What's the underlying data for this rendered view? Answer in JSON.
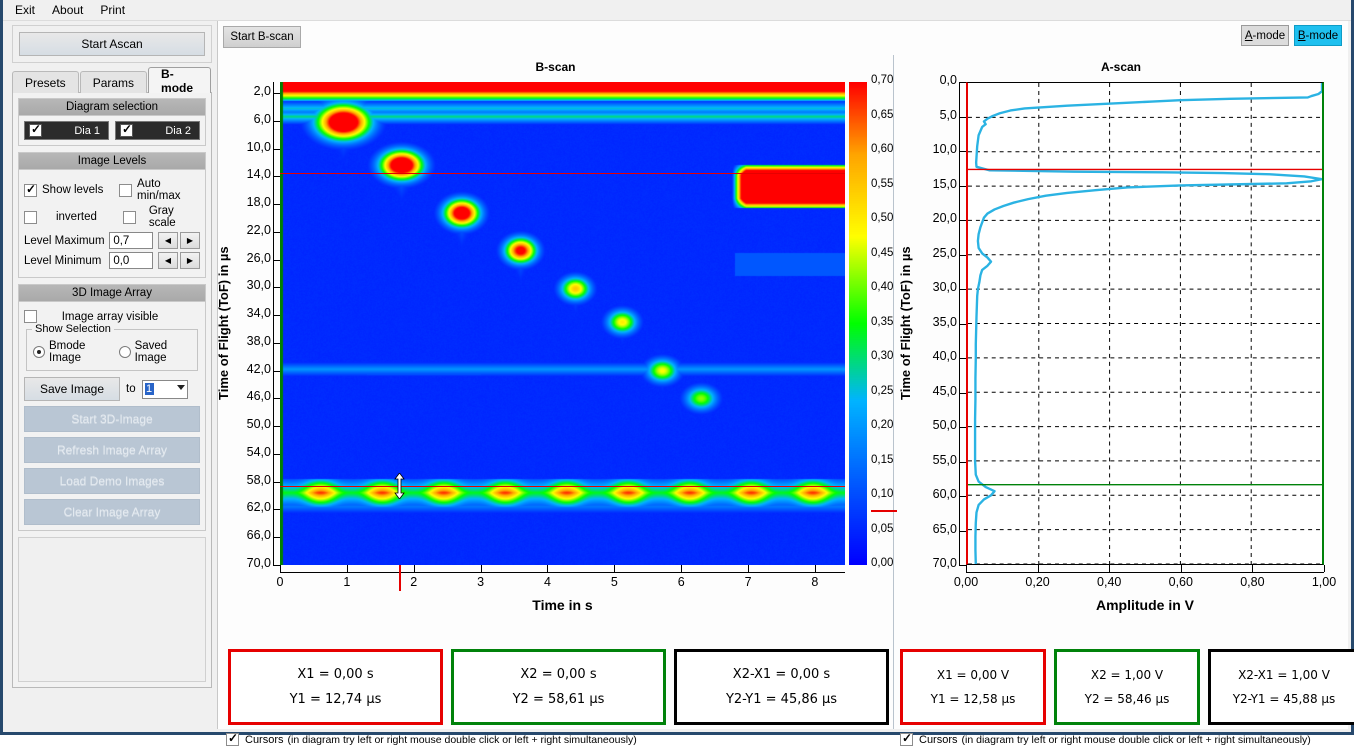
{
  "menu": {
    "items": [
      "Exit",
      "About",
      "Print"
    ]
  },
  "left": {
    "start_ascan": "Start Ascan",
    "tabs": [
      {
        "label": "Presets",
        "active": false
      },
      {
        "label": "Params",
        "active": false
      },
      {
        "label": "B-mode",
        "active": true
      }
    ],
    "diagram_selection": {
      "title": "Diagram selection",
      "items": [
        {
          "label": "Dia 1",
          "checked": true
        },
        {
          "label": "Dia 2",
          "checked": true
        }
      ]
    },
    "image_levels": {
      "title": "Image Levels",
      "show_levels": {
        "label": "Show levels",
        "checked": true
      },
      "auto_minmax": {
        "label": "Auto min/max",
        "checked": false
      },
      "inverted": {
        "label": "inverted",
        "checked": false
      },
      "gray_scale": {
        "label": "Gray scale",
        "checked": false
      },
      "level_maximum": {
        "label": "Level Maximum",
        "value": "0,7"
      },
      "level_minimum": {
        "label": "Level Minimum",
        "value": "0,0"
      }
    },
    "image_array": {
      "title": "3D Image Array",
      "array_visible": {
        "label": "Image array visible",
        "checked": false
      },
      "show_selection": {
        "legend": "Show Selection",
        "options": [
          {
            "label": "Bmode Image",
            "selected": true
          },
          {
            "label": "Saved Image",
            "selected": false
          }
        ]
      },
      "save_image": "Save Image",
      "to_label": "to",
      "slot_value": "1",
      "buttons": [
        "Start 3D-Image",
        "Refresh Image Array",
        "Load Demo Images",
        "Clear Image Array"
      ]
    }
  },
  "toolbar": {
    "start_bscan": "Start B-scan",
    "mode_buttons": [
      {
        "mnemonic": "A",
        "rest": "-mode",
        "active": false
      },
      {
        "mnemonic": "B",
        "rest": "-mode",
        "active": true
      }
    ]
  },
  "chart_data": [
    {
      "type": "heatmap",
      "title": "B-scan",
      "xlabel": "Time in s",
      "ylabel": "Time of Flight (ToF) in µs",
      "xlim": [
        0,
        8.45
      ],
      "ylim": [
        0.4,
        70.0
      ],
      "xticks": [
        "0",
        "1",
        "2",
        "3",
        "4",
        "5",
        "6",
        "7",
        "8"
      ],
      "yticks": [
        "2,0",
        "6,0",
        "10,0",
        "14,0",
        "18,0",
        "22,0",
        "26,0",
        "30,0",
        "34,0",
        "38,0",
        "42,0",
        "46,0",
        "50,0",
        "54,0",
        "58,0",
        "62,0",
        "66,0",
        "70,0"
      ],
      "colorbar": {
        "ticks": [
          "0,70",
          "0,65",
          "0,60",
          "0,55",
          "0,50",
          "0,45",
          "0,40",
          "0,35",
          "0,30",
          "0,25",
          "0,20",
          "0,15",
          "0,10",
          "0,05",
          "0,00"
        ],
        "min": 0.0,
        "max": 0.7,
        "marker_value": 0.08
      },
      "cursor_y1": 13.45,
      "cursor_y2": 58.6,
      "cursor_x_marker": 1.78,
      "surface_echo_band": {
        "from": 0.4,
        "to": 3.2,
        "value": 0.7
      },
      "blobs": [
        {
          "x": 0.95,
          "y": 6.2,
          "rx": 0.3,
          "ry": 1.9,
          "peak": 0.95
        },
        {
          "x": 1.82,
          "y": 12.4,
          "rx": 0.24,
          "ry": 1.6,
          "peak": 0.92
        },
        {
          "x": 2.72,
          "y": 19.3,
          "rx": 0.2,
          "ry": 1.5,
          "peak": 0.85
        },
        {
          "x": 3.6,
          "y": 24.7,
          "rx": 0.18,
          "ry": 1.4,
          "peak": 0.75
        },
        {
          "x": 4.42,
          "y": 30.2,
          "rx": 0.17,
          "ry": 1.3,
          "peak": 0.55
        },
        {
          "x": 5.12,
          "y": 35.0,
          "rx": 0.17,
          "ry": 1.3,
          "peak": 0.5
        },
        {
          "x": 5.72,
          "y": 42.0,
          "rx": 0.18,
          "ry": 1.3,
          "peak": 0.48
        },
        {
          "x": 6.3,
          "y": 46.0,
          "rx": 0.18,
          "ry": 1.3,
          "peak": 0.42
        }
      ],
      "back_wall": {
        "y": 59.6,
        "thickness": 2.0,
        "value": 0.42
      },
      "right_block": {
        "x_from": 6.75,
        "x_to": 8.45,
        "y_from": 13.8,
        "y_to": 17.2,
        "value": 0.85
      }
    },
    {
      "type": "line",
      "title": "A-scan",
      "xlabel": "Amplitude in V",
      "ylabel": "Time of Flight (ToF) in µs",
      "xlim": [
        0,
        1.0
      ],
      "ylim": [
        0,
        70.0
      ],
      "xticks": [
        "0,00",
        "0,20",
        "0,40",
        "0,60",
        "0,80",
        "1,00"
      ],
      "yticks": [
        "0,0",
        "5,0",
        "10,0",
        "15,0",
        "20,0",
        "25,0",
        "30,0",
        "35,0",
        "40,0",
        "45,0",
        "50,0",
        "55,0",
        "60,0",
        "65,0",
        "70,0"
      ],
      "series_color": "#2BB3E3",
      "cursor_y1": 12.58,
      "cursor_y2": 58.46,
      "series": [
        {
          "name": "Amplitude",
          "points": [
            [
              1.0,
              0.0
            ],
            [
              1.0,
              1.2
            ],
            [
              0.99,
              1.6
            ],
            [
              0.97,
              1.9
            ],
            [
              0.96,
              2.1
            ],
            [
              0.74,
              2.3
            ],
            [
              0.6,
              2.5
            ],
            [
              0.52,
              2.7
            ],
            [
              0.44,
              2.9
            ],
            [
              0.36,
              3.1
            ],
            [
              0.28,
              3.3
            ],
            [
              0.22,
              3.5
            ],
            [
              0.16,
              3.7
            ],
            [
              0.12,
              4.0
            ],
            [
              0.09,
              4.4
            ],
            [
              0.07,
              4.8
            ],
            [
              0.055,
              5.2
            ],
            [
              0.045,
              5.6
            ],
            [
              0.05,
              6.0
            ],
            [
              0.04,
              6.4
            ],
            [
              0.035,
              7.0
            ],
            [
              0.03,
              7.6
            ],
            [
              0.028,
              8.4
            ],
            [
              0.026,
              9.2
            ],
            [
              0.025,
              10.0
            ],
            [
              0.024,
              10.8
            ],
            [
              0.023,
              11.6
            ],
            [
              0.024,
              12.2
            ],
            [
              0.06,
              12.7
            ],
            [
              0.3,
              12.9
            ],
            [
              0.55,
              13.0
            ],
            [
              0.72,
              13.1
            ],
            [
              0.86,
              13.3
            ],
            [
              0.95,
              13.6
            ],
            [
              1.0,
              14.0
            ],
            [
              0.97,
              14.3
            ],
            [
              0.9,
              14.6
            ],
            [
              0.6,
              14.9
            ],
            [
              0.45,
              15.2
            ],
            [
              0.36,
              15.6
            ],
            [
              0.28,
              16.0
            ],
            [
              0.22,
              16.4
            ],
            [
              0.17,
              16.9
            ],
            [
              0.13,
              17.4
            ],
            [
              0.1,
              17.9
            ],
            [
              0.075,
              18.4
            ],
            [
              0.055,
              19.0
            ],
            [
              0.045,
              19.6
            ],
            [
              0.04,
              20.3
            ],
            [
              0.035,
              21.0
            ],
            [
              0.03,
              22.0
            ],
            [
              0.028,
              23.0
            ],
            [
              0.03,
              24.0
            ],
            [
              0.04,
              24.8
            ],
            [
              0.055,
              25.4
            ],
            [
              0.065,
              26.0
            ],
            [
              0.055,
              26.6
            ],
            [
              0.04,
              27.2
            ],
            [
              0.035,
              28.0
            ],
            [
              0.032,
              29.0
            ],
            [
              0.028,
              30.0
            ],
            [
              0.026,
              31.0
            ],
            [
              0.025,
              32.5
            ],
            [
              0.024,
              34.0
            ],
            [
              0.023,
              36.0
            ],
            [
              0.022,
              38.0
            ],
            [
              0.022,
              40.0
            ],
            [
              0.021,
              43.0
            ],
            [
              0.021,
              46.0
            ],
            [
              0.02,
              49.0
            ],
            [
              0.02,
              52.0
            ],
            [
              0.02,
              55.0
            ],
            [
              0.022,
              57.0
            ],
            [
              0.03,
              58.0
            ],
            [
              0.05,
              58.8
            ],
            [
              0.075,
              59.4
            ],
            [
              0.065,
              60.0
            ],
            [
              0.045,
              60.6
            ],
            [
              0.03,
              61.4
            ],
            [
              0.024,
              62.5
            ],
            [
              0.022,
              64.0
            ],
            [
              0.021,
              66.0
            ],
            [
              0.021,
              68.0
            ],
            [
              0.022,
              70.0
            ]
          ]
        }
      ]
    }
  ],
  "cursors_bscan": {
    "boxes": [
      {
        "color": "red",
        "line1": "X1 =   0,00 s",
        "line2": "Y1 = 12,74 µs"
      },
      {
        "color": "green",
        "line1": "X2 =   0,00 s",
        "line2": "Y2 = 58,61 µs"
      },
      {
        "color": "black",
        "line1": "X2-X1 =   0,00 s",
        "line2": "Y2-Y1 = 45,86 µs"
      }
    ],
    "checkbox": {
      "label": "Cursors",
      "checked": true
    },
    "note": "(in diagram try left or right  mouse double click or left + right simultaneously)"
  },
  "cursors_ascan": {
    "boxes": [
      {
        "color": "red",
        "line1": "X1 =   0,00 V",
        "line2": "Y1 = 12,58 µs"
      },
      {
        "color": "green",
        "line1": "X2 =   1,00 V",
        "line2": "Y2 = 58,46 µs"
      },
      {
        "color": "black",
        "line1": "X2-X1 =   1,00 V",
        "line2": "Y2-Y1 = 45,88 µs"
      }
    ],
    "checkbox": {
      "label": "Cursors",
      "checked": true
    },
    "note": "(in diagram try left or right  mouse double click or left + right simultaneously)"
  },
  "colors": {
    "cursor_red": "#e60000",
    "cursor_green": "#00820a",
    "accent_active": "#1fc0ef",
    "trace": "#2BB3E3",
    "window_border": "#27496d"
  }
}
